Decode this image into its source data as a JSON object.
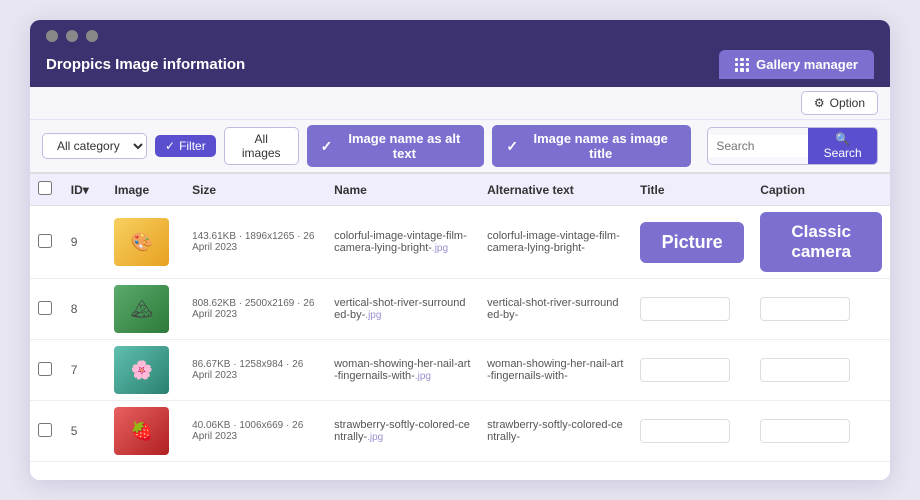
{
  "window": {
    "title": "Droppics Image information"
  },
  "gallery_manager": {
    "label": "Gallery manager"
  },
  "toolbar_top": {
    "option_label": "Option",
    "option_icon": "⚙"
  },
  "toolbar_bottom": {
    "category_label": "All category",
    "filter_label": "Filter",
    "all_images_label": "All images",
    "toggle_alt_label": "Image name as alt text",
    "toggle_title_label": "Image name as image title",
    "search_placeholder": "Search",
    "search_btn_label": "Search"
  },
  "table": {
    "headers": [
      "",
      "ID▾",
      "Image",
      "Size",
      "Name",
      "Alternative text",
      "Title",
      "Caption"
    ],
    "rows": [
      {
        "id": "9",
        "thumb_class": "thumb-yellow",
        "thumb_emoji": "🎨",
        "size": "143.61KB · 1896x1265 · 26 April 2023",
        "name": "colorful-image-vintage-film-camera-lying-bright-",
        "name_ext": ".jpg",
        "alt_text": "colorful-image-vintage-film-camera-lying-bright-",
        "title_value": "Picture",
        "title_is_badge": true,
        "caption_value": "Classic camera",
        "caption_is_badge": true
      },
      {
        "id": "8",
        "thumb_class": "thumb-green",
        "thumb_emoji": "🏔",
        "size": "808.62KB · 2500x2169 · 26 April 2023",
        "name": "vertical-shot-river-surrounded-by-",
        "name_ext": ".jpg",
        "alt_text": "vertical-shot-river-surrounded-by-",
        "title_value": "",
        "title_is_badge": false,
        "caption_value": "",
        "caption_is_badge": false
      },
      {
        "id": "7",
        "thumb_class": "thumb-teal",
        "thumb_emoji": "🌸",
        "size": "86.67KB · 1258x984 · 26 April 2023",
        "name": "woman-showing-her-nail-art-fingernails-with-",
        "name_ext": ".jpg",
        "alt_text": "woman-showing-her-nail-art-fingernails-with-",
        "title_value": "",
        "title_is_badge": false,
        "caption_value": "",
        "caption_is_badge": false
      },
      {
        "id": "5",
        "thumb_class": "thumb-red",
        "thumb_emoji": "🍓",
        "size": "40.06KB · 1006x669 · 26 April 2023",
        "name": "strawberry-softly-colored-centrally-",
        "name_ext": ".jpg",
        "alt_text": "strawberry-softly-colored-centrally-",
        "title_value": "",
        "title_is_badge": false,
        "caption_value": "",
        "caption_is_badge": false
      }
    ]
  }
}
